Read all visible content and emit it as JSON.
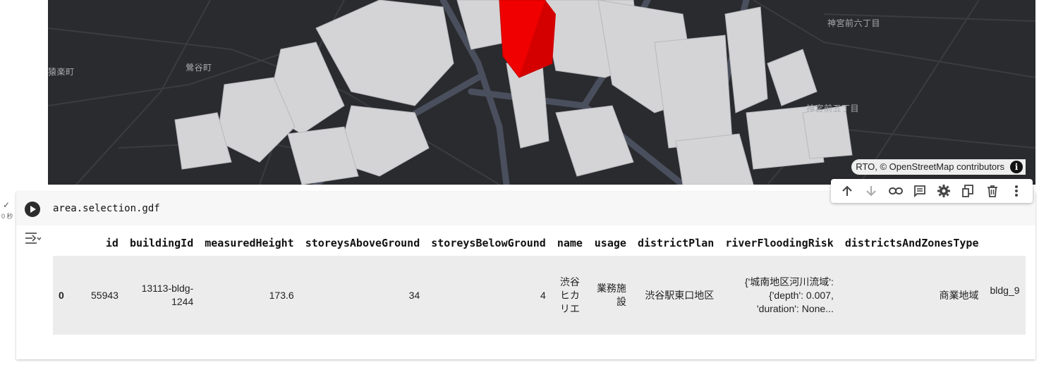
{
  "map": {
    "labels": [
      "神宮前六丁目",
      "鶯谷町",
      "猿楽町",
      "神宮前五丁目"
    ],
    "attribution": "RTO, © OpenStreetMap contributors",
    "info_icon": "i"
  },
  "cell": {
    "status_check": "✓",
    "exec_time": "0 秒",
    "code": "area.selection.gdf"
  },
  "toolbar": {
    "icons": [
      "arrow-up-icon",
      "arrow-down-icon",
      "link-icon",
      "comment-icon",
      "gear-icon",
      "mirror-icon",
      "trash-icon",
      "more-vert-icon"
    ]
  },
  "table": {
    "columns": [
      "",
      "id",
      "buildingId",
      "measuredHeight",
      "storeysAboveGround",
      "storeysBelowGround",
      "name",
      "usage",
      "districtPlan",
      "riverFloodingRisk",
      "districtsAndZonesType",
      ""
    ],
    "rows": [
      {
        "index": "0",
        "id": "55943",
        "buildingId": "13113-bldg-1244",
        "measuredHeight": "173.6",
        "storeysAboveGround": "34",
        "storeysBelowGround": "4",
        "name": "渋谷ヒカリエ",
        "usage": "業務施設",
        "districtPlan": "渋谷駅東口地区",
        "riverFloodingRisk": "{'城南地区河川流域': {'depth': 0.007, 'duration': None...",
        "districtsAndZonesType": "商業地域",
        "extra": "bldg_9"
      }
    ]
  }
}
